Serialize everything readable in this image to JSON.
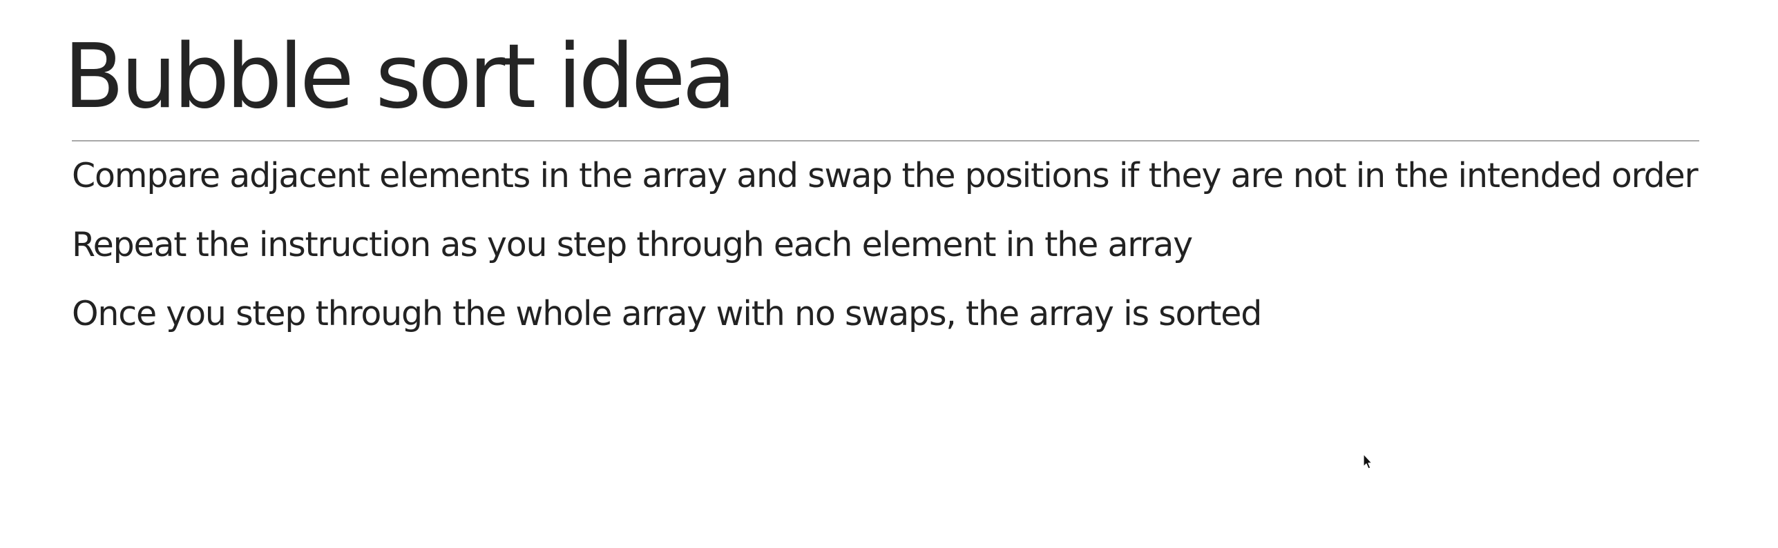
{
  "slide": {
    "title": "Bubble sort idea",
    "bullets": [
      "Compare adjacent elements in the array and swap the positions if they are not in the intended order",
      "Repeat the instruction as you step through each element in the array",
      "Once you step through the whole array with no swaps, the array is sorted"
    ],
    "cursor_icon": "mouse-pointer-icon"
  }
}
